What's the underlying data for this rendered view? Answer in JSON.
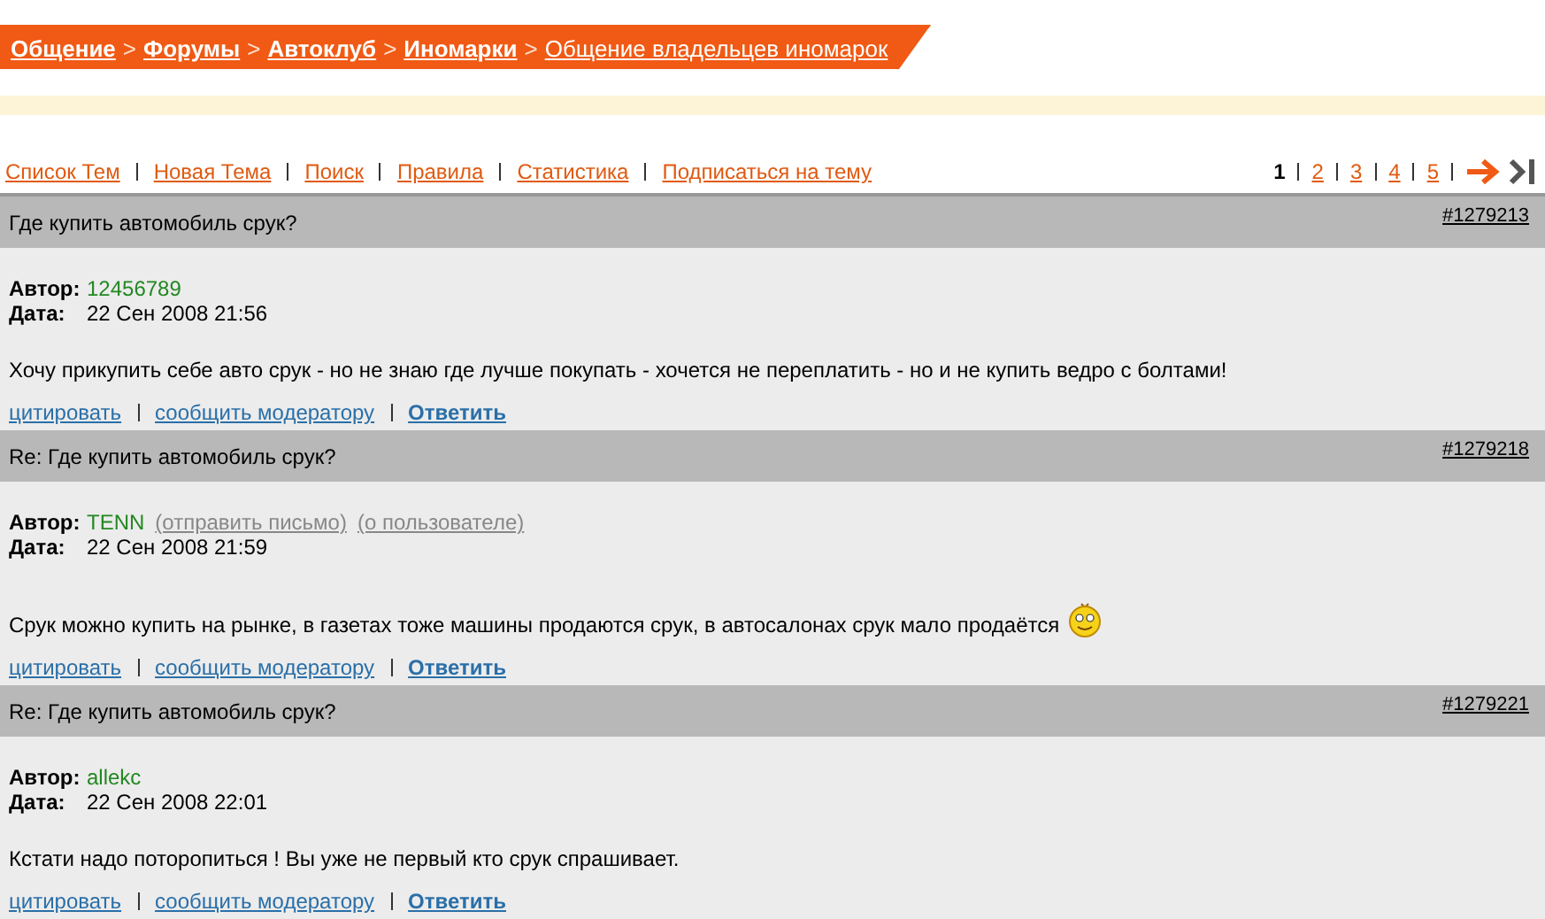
{
  "breadcrumbs": [
    {
      "label": "Общение",
      "bold": true
    },
    {
      "label": "Форумы",
      "bold": true
    },
    {
      "label": "Автоклуб",
      "bold": true
    },
    {
      "label": "Иномарки",
      "bold": true
    },
    {
      "label": "Общение владельцев иномарок",
      "bold": false
    }
  ],
  "separator": ">",
  "nav_links": [
    "Список Тем",
    "Новая Тема",
    "Поиск",
    "Правила",
    "Статистика",
    "Подписаться на тему"
  ],
  "pages": [
    {
      "label": "1",
      "selected": true
    },
    {
      "label": "2",
      "selected": false
    },
    {
      "label": "3",
      "selected": false
    },
    {
      "label": "4",
      "selected": false
    },
    {
      "label": "5",
      "selected": false
    }
  ],
  "posts": [
    {
      "title": "Где купить автомобиль срук?",
      "number": "#1279213",
      "author_label": "Автор:",
      "author": "12456789",
      "date_label": "Дата:",
      "date": "22 Сен 2008 21:56",
      "text": "Хочу прикупить себе авто срук - но не знаю где лучше покупать - хочется не переплатить - но и не купить ведро с болтами!",
      "emoticon": false,
      "actions": [
        "цитировать",
        "сообщить модератору",
        "Ответить"
      ]
    },
    {
      "title": "Re: Где купить автомобиль срук?",
      "number": "#1279218",
      "author_label": "Автор:",
      "author": "TENN",
      "author_links": [
        "(отправить письмо)",
        "(о пользователе)"
      ],
      "date_label": "Дата:",
      "date": "22 Сен 2008 21:59",
      "text": "Срук можно купить на рынке, в газетах тоже машины продаются срук, в автосалонах срук мало продаётся",
      "emoticon": true,
      "actions": [
        "цитировать",
        "сообщить модератору",
        "Ответить"
      ]
    },
    {
      "title": "Re: Где купить автомобиль срук?",
      "number": "#1279221",
      "author_label": "Автор:",
      "author": "allekc",
      "date_label": "Дата:",
      "date": "22 Сен 2008 22:01",
      "text": "Кстати надо поторопиться ! Вы уже не первый кто срук спрашивает.",
      "emoticon": false,
      "actions": [
        "цитировать",
        "сообщить модератору",
        "Ответить"
      ]
    }
  ]
}
